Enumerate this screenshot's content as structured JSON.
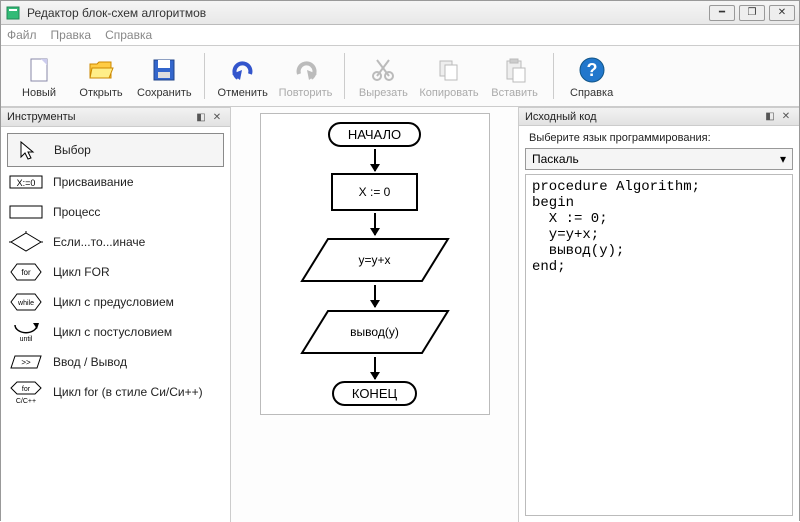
{
  "window": {
    "title": "Редактор блок-схем алгоритмов"
  },
  "menu": {
    "file": "Файл",
    "edit": "Правка",
    "help": "Справка"
  },
  "toolbar": {
    "new": "Новый",
    "open": "Открыть",
    "save": "Сохранить",
    "undo": "Отменить",
    "redo": "Повторить",
    "cut": "Вырезать",
    "copy": "Копировать",
    "paste": "Вставить",
    "help": "Справка"
  },
  "panels": {
    "tools_title": "Инструменты",
    "code_title": "Исходный код"
  },
  "tools": [
    {
      "label": "Выбор"
    },
    {
      "label": "Присваивание"
    },
    {
      "label": "Процесс"
    },
    {
      "label": "Если...то...иначе"
    },
    {
      "label": "Цикл FOR"
    },
    {
      "label": "Цикл с предусловием"
    },
    {
      "label": "Цикл с постусловием"
    },
    {
      "label": "Ввод / Вывод"
    },
    {
      "label": "Цикл for (в стиле Си/Си++)"
    }
  ],
  "flowchart": {
    "start": "НАЧАЛО",
    "assign": "X := 0",
    "io1": "y=y+x",
    "io2": "вывод(y)",
    "end": "КОНЕЦ"
  },
  "code_panel": {
    "lang_label": "Выберите язык программирования:",
    "lang_value": "Паскаль",
    "code": "procedure Algorithm;\nbegin\n  X := 0;\n  y=y+x;\n  вывод(y);\nend;"
  }
}
